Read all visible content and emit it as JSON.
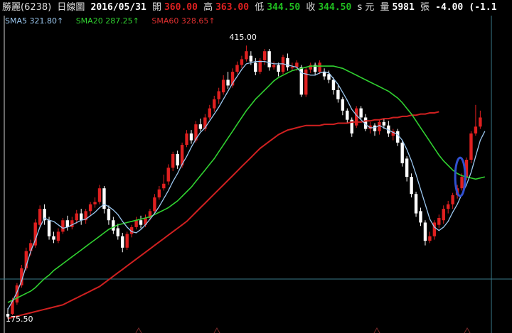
{
  "header": {
    "name": "勝麗(6238)",
    "period": "日線圖",
    "date": "2016/05/31",
    "open_label": "開",
    "open": "360.00",
    "high_label": "高",
    "high": "363.00",
    "low_label": "低",
    "low": "344.50",
    "close_label": "收",
    "close": "344.50",
    "unit": "s 元",
    "vol_label": "量",
    "volume": "5981",
    "vol_unit": "張",
    "change": "-4.00",
    "change_pct": "(-1.1"
  },
  "legend": {
    "sma5": "SMA5 321.80↑",
    "sma20": "SMA20 287.25↑",
    "sma60": "SMA60 328.65↑"
  },
  "labels": {
    "max_price": "415.00",
    "min_price": "175.50"
  },
  "colors": {
    "up": "#e02020",
    "down": "#ffffff",
    "sma5": "#9cc8f0",
    "sma20": "#30d030",
    "sma60": "#d02020",
    "grid": "#3a7a8a"
  },
  "chart_data": {
    "type": "candlestick",
    "ylim": [
      172,
      430
    ],
    "candles": [
      [
        180,
        178,
        185,
        176
      ],
      [
        180,
        192,
        194,
        179
      ],
      [
        190,
        205,
        207,
        188
      ],
      [
        205,
        220,
        223,
        203
      ],
      [
        220,
        235,
        238,
        218
      ],
      [
        235,
        242,
        245,
        231
      ],
      [
        240,
        260,
        263,
        238
      ],
      [
        258,
        272,
        275,
        255
      ],
      [
        272,
        262,
        276,
        258
      ],
      [
        262,
        248,
        265,
        245
      ],
      [
        248,
        245,
        252,
        242
      ],
      [
        244,
        252,
        255,
        242
      ],
      [
        252,
        262,
        264,
        250
      ],
      [
        262,
        256,
        266,
        253
      ],
      [
        256,
        262,
        265,
        254
      ],
      [
        262,
        268,
        271,
        259
      ],
      [
        268,
        262,
        272,
        258
      ],
      [
        262,
        270,
        272,
        259
      ],
      [
        270,
        276,
        278,
        266
      ],
      [
        276,
        278,
        282,
        273
      ],
      [
        278,
        290,
        293,
        276
      ],
      [
        290,
        272,
        292,
        268
      ],
      [
        272,
        262,
        275,
        258
      ],
      [
        262,
        253,
        265,
        250
      ],
      [
        255,
        248,
        259,
        245
      ],
      [
        248,
        238,
        251,
        234
      ],
      [
        238,
        250,
        252,
        236
      ],
      [
        250,
        256,
        258,
        247
      ],
      [
        256,
        262,
        265,
        254
      ],
      [
        262,
        258,
        266,
        255
      ],
      [
        258,
        264,
        267,
        256
      ],
      [
        264,
        270,
        272,
        262
      ],
      [
        270,
        282,
        285,
        268
      ],
      [
        282,
        289,
        292,
        280
      ],
      [
        290,
        294,
        302,
        288
      ],
      [
        296,
        308,
        311,
        293
      ],
      [
        308,
        320,
        322,
        305
      ],
      [
        320,
        310,
        323,
        307
      ],
      [
        310,
        328,
        330,
        308
      ],
      [
        328,
        338,
        341,
        326
      ],
      [
        338,
        332,
        341,
        329
      ],
      [
        332,
        346,
        349,
        330
      ],
      [
        346,
        342,
        351,
        340
      ],
      [
        342,
        352,
        355,
        340
      ],
      [
        352,
        360,
        363,
        350
      ],
      [
        360,
        368,
        371,
        357
      ],
      [
        368,
        375,
        378,
        364
      ],
      [
        374,
        385,
        389,
        372
      ],
      [
        385,
        380,
        392,
        377
      ],
      [
        380,
        392,
        395,
        378
      ],
      [
        392,
        398,
        401,
        390
      ],
      [
        398,
        403,
        406,
        395
      ],
      [
        403,
        410,
        415,
        401
      ],
      [
        406,
        401,
        410,
        398
      ],
      [
        400,
        392,
        404,
        389
      ],
      [
        392,
        402,
        404,
        390
      ],
      [
        402,
        410,
        412,
        398
      ],
      [
        410,
        396,
        412,
        393
      ],
      [
        396,
        398,
        401,
        394
      ],
      [
        398,
        392,
        400,
        388
      ],
      [
        392,
        405,
        407,
        390
      ],
      [
        404,
        396,
        408,
        393
      ],
      [
        396,
        396,
        400,
        393
      ],
      [
        396,
        400,
        402,
        393
      ],
      [
        396,
        372,
        398,
        370
      ],
      [
        372,
        394,
        396,
        370
      ],
      [
        394,
        398,
        400,
        391
      ],
      [
        398,
        392,
        400,
        389
      ],
      [
        392,
        400,
        402,
        390
      ],
      [
        392,
        388,
        395,
        385
      ],
      [
        390,
        385,
        393,
        382
      ],
      [
        385,
        376,
        387,
        372
      ],
      [
        376,
        368,
        380,
        365
      ],
      [
        368,
        358,
        370,
        354
      ],
      [
        358,
        350,
        360,
        347
      ],
      [
        350,
        338,
        352,
        335
      ],
      [
        345,
        360,
        362,
        343
      ],
      [
        360,
        352,
        362,
        350
      ],
      [
        352,
        342,
        355,
        340
      ],
      [
        342,
        345,
        348,
        338
      ],
      [
        345,
        340,
        347,
        336
      ],
      [
        340,
        348,
        350,
        337
      ],
      [
        348,
        345,
        351,
        342
      ],
      [
        345,
        338,
        349,
        335
      ],
      [
        336,
        340,
        342,
        332
      ],
      [
        340,
        330,
        342,
        327
      ],
      [
        330,
        312,
        332,
        309
      ],
      [
        316,
        300,
        318,
        296
      ],
      [
        300,
        285,
        303,
        282
      ],
      [
        285,
        268,
        287,
        265
      ],
      [
        270,
        260,
        273,
        257
      ],
      [
        260,
        244,
        262,
        240
      ],
      [
        244,
        248,
        252,
        242
      ],
      [
        248,
        260,
        262,
        245
      ],
      [
        258,
        264,
        267,
        255
      ],
      [
        262,
        272,
        275,
        259
      ],
      [
        272,
        276,
        279,
        268
      ],
      [
        276,
        284,
        286,
        272
      ],
      [
        284,
        290,
        293,
        281
      ],
      [
        290,
        300,
        303,
        288
      ],
      [
        300,
        315,
        317,
        297
      ],
      [
        315,
        338,
        340,
        312
      ],
      [
        338,
        344,
        363,
        336
      ],
      [
        344,
        352,
        358,
        342
      ]
    ],
    "sma5": [
      184,
      191,
      199,
      209,
      222,
      235,
      245,
      256,
      264,
      262,
      261,
      258,
      255,
      256,
      258,
      260,
      262,
      263,
      266,
      269,
      273,
      276,
      274,
      271,
      267,
      261,
      256,
      252,
      251,
      254,
      258,
      263,
      268,
      274,
      281,
      288,
      296,
      303,
      311,
      318,
      326,
      333,
      339,
      343,
      349,
      355,
      361,
      368,
      375,
      382,
      388,
      394,
      399,
      400,
      401,
      401,
      401,
      400,
      399,
      399,
      399,
      398,
      397,
      396,
      391,
      390,
      389,
      389,
      391,
      392,
      391,
      386,
      381,
      374,
      367,
      359,
      354,
      350,
      346,
      343,
      343,
      345,
      343,
      341,
      339,
      337,
      332,
      324,
      314,
      302,
      289,
      276,
      263,
      256,
      253,
      256,
      261,
      269,
      276,
      285,
      293,
      304,
      318,
      332,
      340
    ],
    "sma20": [
      190,
      192,
      194,
      196,
      198,
      200,
      203,
      207,
      211,
      214,
      218,
      221,
      224,
      227,
      230,
      233,
      236,
      239,
      242,
      245,
      248,
      251,
      254,
      256,
      258,
      259,
      260,
      261,
      262,
      263,
      264,
      265,
      267,
      269,
      271,
      273,
      276,
      279,
      283,
      287,
      291,
      296,
      301,
      306,
      311,
      316,
      322,
      328,
      334,
      340,
      346,
      352,
      358,
      363,
      368,
      372,
      376,
      380,
      384,
      387,
      389,
      391,
      393,
      394,
      395,
      396,
      397,
      397,
      397,
      397,
      397,
      397,
      396,
      395,
      393,
      391,
      389,
      387,
      385,
      383,
      381,
      379,
      377,
      375,
      372,
      369,
      365,
      360,
      355,
      349,
      343,
      337,
      331,
      325,
      319,
      314,
      310,
      306,
      303,
      301,
      300,
      299,
      298,
      299,
      300
    ],
    "sma60": [
      176,
      177,
      178,
      179,
      180,
      181,
      182,
      183,
      184,
      185,
      186,
      187,
      188,
      190,
      192,
      194,
      196,
      198,
      200,
      202,
      204,
      207,
      210,
      213,
      216,
      219,
      222,
      225,
      228,
      231,
      234,
      237,
      240,
      243,
      246,
      249,
      252,
      255,
      258,
      261,
      265,
      269,
      273,
      277,
      281,
      285,
      289,
      293,
      297,
      301,
      305,
      309,
      313,
      317,
      321,
      325,
      328,
      331,
      334,
      337,
      339,
      341,
      342,
      343,
      344,
      345,
      345,
      345,
      345,
      346,
      346,
      346,
      347,
      347,
      347,
      348,
      348,
      348,
      349,
      349,
      350,
      350,
      351,
      351,
      352,
      352,
      353,
      353,
      354,
      354,
      355,
      355,
      356,
      356,
      357
    ]
  }
}
